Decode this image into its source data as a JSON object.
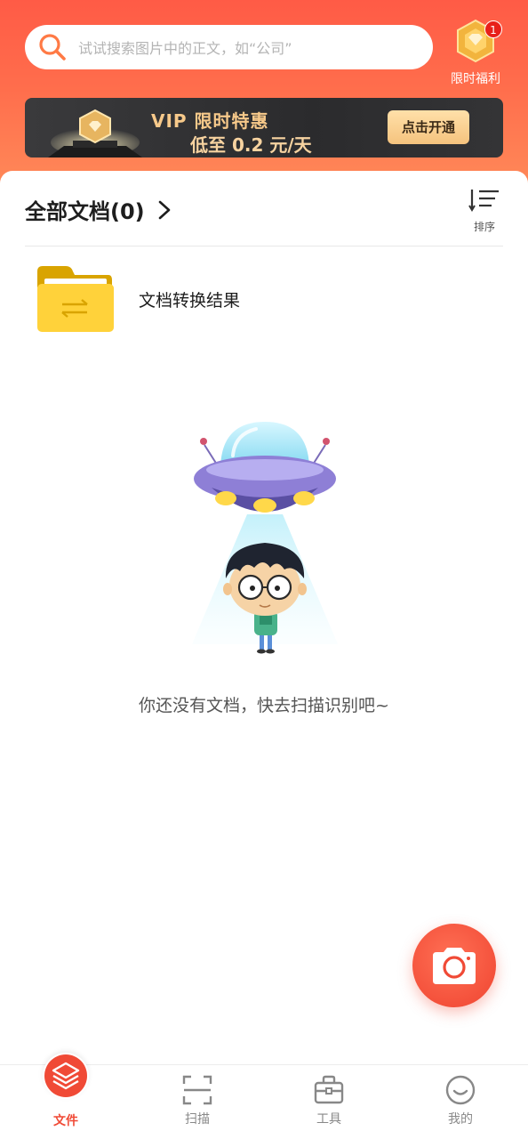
{
  "search": {
    "placeholder": "试试搜索图片中的正文，如“公司”",
    "icon": "search-icon"
  },
  "welfare": {
    "label": "限时福利",
    "badge_count": "1",
    "icon": "diamond-gem-icon"
  },
  "vip_banner": {
    "line1": "VIP 限时特惠",
    "line2": "低至 0.2 元/天",
    "button_label": "点击开通"
  },
  "documents": {
    "title": "全部文档(0)",
    "sort_label": "排序",
    "folders": [
      {
        "name": "文档转换结果",
        "icon": "folder-convert-icon"
      }
    ],
    "empty_text": "你还没有文档，快去扫描识别吧~"
  },
  "fab": {
    "icon": "camera-icon"
  },
  "bottom_nav": {
    "items": [
      {
        "label": "文件",
        "icon": "layers-icon",
        "active": true
      },
      {
        "label": "扫描",
        "icon": "scan-icon",
        "active": false
      },
      {
        "label": "工具",
        "icon": "toolbox-icon",
        "active": false
      },
      {
        "label": "我的",
        "icon": "smile-icon",
        "active": false
      }
    ]
  },
  "colors": {
    "accent": "#f04a36",
    "header_top": "#ff5b46",
    "header_bottom": "#ff8a59",
    "vip_gold": "#f7c98a",
    "folder_yellow": "#ffd23a"
  }
}
